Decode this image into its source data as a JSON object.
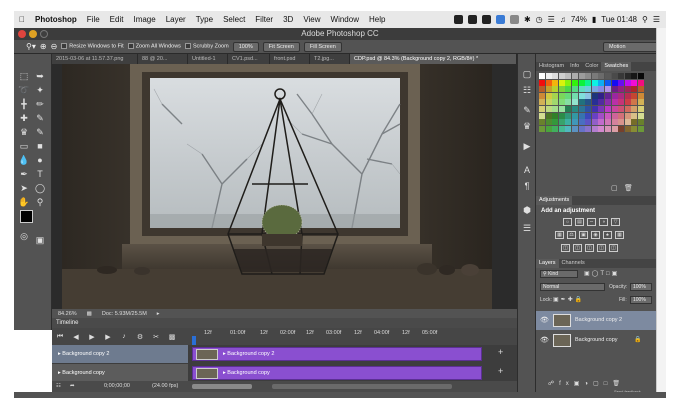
{
  "menubar": {
    "apple": "",
    "items": [
      "Photoshop",
      "File",
      "Edit",
      "Image",
      "Layer",
      "Type",
      "Select",
      "Filter",
      "3D",
      "View",
      "Window",
      "Help"
    ],
    "battery": "74%",
    "clock": "Tue 01:48"
  },
  "window": {
    "title": "Adobe Photoshop CC"
  },
  "options": {
    "resize_windows": "Resize Windows to Fit",
    "zoom_all": "Zoom All Windows",
    "scrubby": "Scrubby Zoom",
    "btn_100": "100%",
    "fit_screen": "Fit Screen",
    "fill_screen": "Fill Screen",
    "workspace": "Motion"
  },
  "tabs": [
    {
      "label": "2015-03-06 at 11.57.37.png"
    },
    {
      "label": "88 @ 20..."
    },
    {
      "label": "Untitled-1"
    },
    {
      "label": "CV1.psd..."
    },
    {
      "label": "front.psd"
    },
    {
      "label": "T2.jpg..."
    },
    {
      "label": "CDP.psd @ 84.3% (Background copy 2, RGB/8#) *"
    }
  ],
  "status": {
    "zoom": "84.26%",
    "doc": "Doc: 5.93M/25.5M"
  },
  "timeline": {
    "title": "Timeline",
    "ruler": [
      "12f",
      "01:00f",
      "12f",
      "02:00f",
      "12f",
      "03:00f",
      "12f",
      "04:00f",
      "12f",
      "05:00f"
    ],
    "tracks": [
      {
        "name": "Background copy 2",
        "clip": "Background copy 2"
      },
      {
        "name": "Background copy",
        "clip": "Background copy"
      }
    ],
    "timecode": "0;00;00;00",
    "fps": "(24.00 fps)"
  },
  "panels": {
    "swatch_tabs": [
      "Histogram",
      "Info",
      "Color",
      "Swatches"
    ],
    "adjustments_title": "Adjustments",
    "add_adjustment": "Add an adjustment",
    "layer_tabs": [
      "Layers",
      "Channels"
    ],
    "kind": "Kind",
    "blend": "Normal",
    "opacity_label": "Opacity:",
    "opacity": "100%",
    "lock_label": "Lock:",
    "fill_label": "Fill:",
    "fill": "100%",
    "layers": [
      {
        "name": "Background copy 2"
      },
      {
        "name": "Background copy"
      }
    ],
    "feedback": "Send feedback"
  }
}
